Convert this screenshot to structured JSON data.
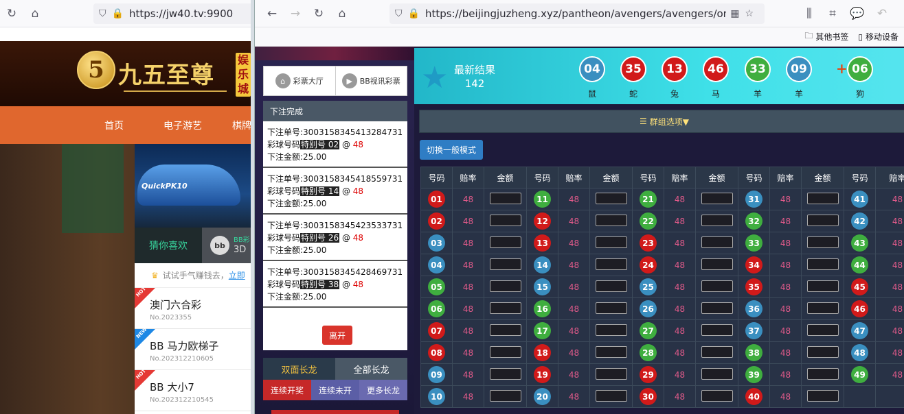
{
  "left_window": {
    "url": "https://jw40.tv:9900",
    "logo": {
      "coin": "5",
      "text": "九五至尊",
      "tag": "娱乐城"
    },
    "nav": [
      "首页",
      "电子游艺",
      "棋牌"
    ],
    "banner_text": "QuickPK10",
    "tabs": {
      "active": "猜你喜欢",
      "other": "BB彩",
      "other2": "3D",
      "bb_icon": "bb"
    },
    "tip": {
      "text": "试试手气赚钱去，",
      "link": "立即"
    },
    "games": [
      {
        "badge": "HOT",
        "title": "澳门六合彩",
        "no": "No.2023355"
      },
      {
        "badge": "NEW",
        "title": "BB 马力欧梯子",
        "no": "No.202312210605"
      },
      {
        "badge": "HOT",
        "title": "BB 大小7",
        "no": "No.202312210545"
      }
    ]
  },
  "right_window": {
    "url": "https://beijingjuzheng.xyz/pantheon/avengers/avengers/origin/",
    "bookmarks": [
      "其他书签",
      "移动设备"
    ],
    "lobby_buttons": [
      "彩票大厅",
      "BB视讯彩票"
    ],
    "bet_panel": {
      "title": "下注完成",
      "order_label": "下注单号:",
      "ball_label": "彩球号码",
      "amount_label": "下注金额:",
      "at": "@",
      "items": [
        {
          "order": "3003158345413284731",
          "ball": "特别号 02",
          "odds": "48",
          "amount": "25.00"
        },
        {
          "order": "3003158345418559731",
          "ball": "特别号 14",
          "odds": "48",
          "amount": "25.00"
        },
        {
          "order": "3003158345423533731",
          "ball": "特别号 26",
          "odds": "48",
          "amount": "25.00"
        },
        {
          "order": "3003158345428469731",
          "ball": "特别号 38",
          "odds": "48",
          "amount": "25.00"
        }
      ],
      "leave": "离开"
    },
    "dragon_tabs": [
      "双面长龙",
      "全部长龙"
    ],
    "dragon_sub": [
      "连续开奖",
      "连续未开",
      "更多长龙"
    ],
    "result": {
      "label": "最新结果",
      "issue": "142",
      "balls": [
        {
          "n": "04",
          "zodiac": "鼠",
          "color": "#3a8fc0"
        },
        {
          "n": "35",
          "zodiac": "蛇",
          "color": "#d11a1a"
        },
        {
          "n": "13",
          "zodiac": "兔",
          "color": "#d11a1a"
        },
        {
          "n": "46",
          "zodiac": "马",
          "color": "#d11a1a"
        },
        {
          "n": "33",
          "zodiac": "羊",
          "color": "#3fae3f"
        },
        {
          "n": "09",
          "zodiac": "羊",
          "color": "#3a8fc0"
        }
      ],
      "plus": "+",
      "special": {
        "n": "06",
        "zodiac": "狗",
        "color": "#3fae3f"
      }
    },
    "group_label": "群组选项▼",
    "switch_label": "切换一般模式",
    "table": {
      "headers": [
        "号码",
        "赔率",
        "金额",
        "号码",
        "赔率",
        "金额",
        "号码",
        "赔率",
        "金额",
        "号码",
        "赔率",
        "金额",
        "号码",
        "赔率"
      ],
      "odds": "48",
      "colors": {
        "red": "#d11a1a",
        "blue": "#3a8fc0",
        "green": "#3fae3f"
      },
      "columns": [
        [
          [
            "01",
            "red"
          ],
          [
            "02",
            "red"
          ],
          [
            "03",
            "blue"
          ],
          [
            "04",
            "blue"
          ],
          [
            "05",
            "green"
          ],
          [
            "06",
            "green"
          ],
          [
            "07",
            "red"
          ],
          [
            "08",
            "red"
          ],
          [
            "09",
            "blue"
          ],
          [
            "10",
            "blue"
          ]
        ],
        [
          [
            "11",
            "green"
          ],
          [
            "12",
            "red"
          ],
          [
            "13",
            "red"
          ],
          [
            "14",
            "blue"
          ],
          [
            "15",
            "blue"
          ],
          [
            "16",
            "green"
          ],
          [
            "17",
            "green"
          ],
          [
            "18",
            "red"
          ],
          [
            "19",
            "red"
          ],
          [
            "20",
            "blue"
          ]
        ],
        [
          [
            "21",
            "green"
          ],
          [
            "22",
            "green"
          ],
          [
            "23",
            "red"
          ],
          [
            "24",
            "red"
          ],
          [
            "25",
            "blue"
          ],
          [
            "26",
            "blue"
          ],
          [
            "27",
            "green"
          ],
          [
            "28",
            "green"
          ],
          [
            "29",
            "red"
          ],
          [
            "30",
            "red"
          ]
        ],
        [
          [
            "31",
            "blue"
          ],
          [
            "32",
            "green"
          ],
          [
            "33",
            "green"
          ],
          [
            "34",
            "red"
          ],
          [
            "35",
            "red"
          ],
          [
            "36",
            "blue"
          ],
          [
            "37",
            "blue"
          ],
          [
            "38",
            "green"
          ],
          [
            "39",
            "green"
          ],
          [
            "40",
            "red"
          ]
        ],
        [
          [
            "41",
            "blue"
          ],
          [
            "42",
            "blue"
          ],
          [
            "43",
            "green"
          ],
          [
            "44",
            "green"
          ],
          [
            "45",
            "red"
          ],
          [
            "46",
            "red"
          ],
          [
            "47",
            "blue"
          ],
          [
            "48",
            "blue"
          ],
          [
            "49",
            "green"
          ]
        ]
      ]
    }
  }
}
